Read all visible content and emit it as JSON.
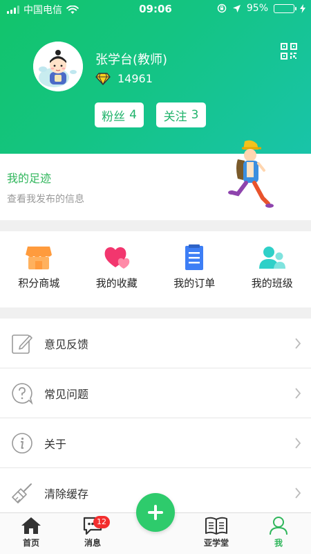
{
  "status_bar": {
    "carrier": "中国电信",
    "time": "09:06",
    "battery_text": "95%",
    "battery_level": 0.95
  },
  "profile": {
    "name": "张学台(教师)",
    "points": "14961",
    "fans_label": "粉丝",
    "fans_count": "4",
    "follow_label": "关注",
    "follow_count": "3"
  },
  "footprint": {
    "title": "我的足迹",
    "subtitle": "查看我发布的信息"
  },
  "quick_links": [
    {
      "label": "积分商城",
      "icon": "shop-icon",
      "color": "#ff9b3d"
    },
    {
      "label": "我的收藏",
      "icon": "heart-icon",
      "color": "#f2366e"
    },
    {
      "label": "我的订单",
      "icon": "document-icon",
      "color": "#3d7ef5"
    },
    {
      "label": "我的班级",
      "icon": "people-icon",
      "color": "#2fd0c8"
    }
  ],
  "menu": [
    {
      "label": "意见反馈",
      "icon": "edit-icon"
    },
    {
      "label": "常见问题",
      "icon": "question-icon"
    },
    {
      "label": "关于",
      "icon": "info-icon"
    },
    {
      "label": "清除缓存",
      "icon": "broom-icon"
    }
  ],
  "tabbar": {
    "home": "首页",
    "messages": "消息",
    "messages_badge": "12",
    "academy": "亚学堂",
    "me": "我"
  },
  "colors": {
    "accent": "#2fb65b",
    "header_start": "#12c46a",
    "header_end": "#19c4a9",
    "badge": "#f32e2e"
  }
}
